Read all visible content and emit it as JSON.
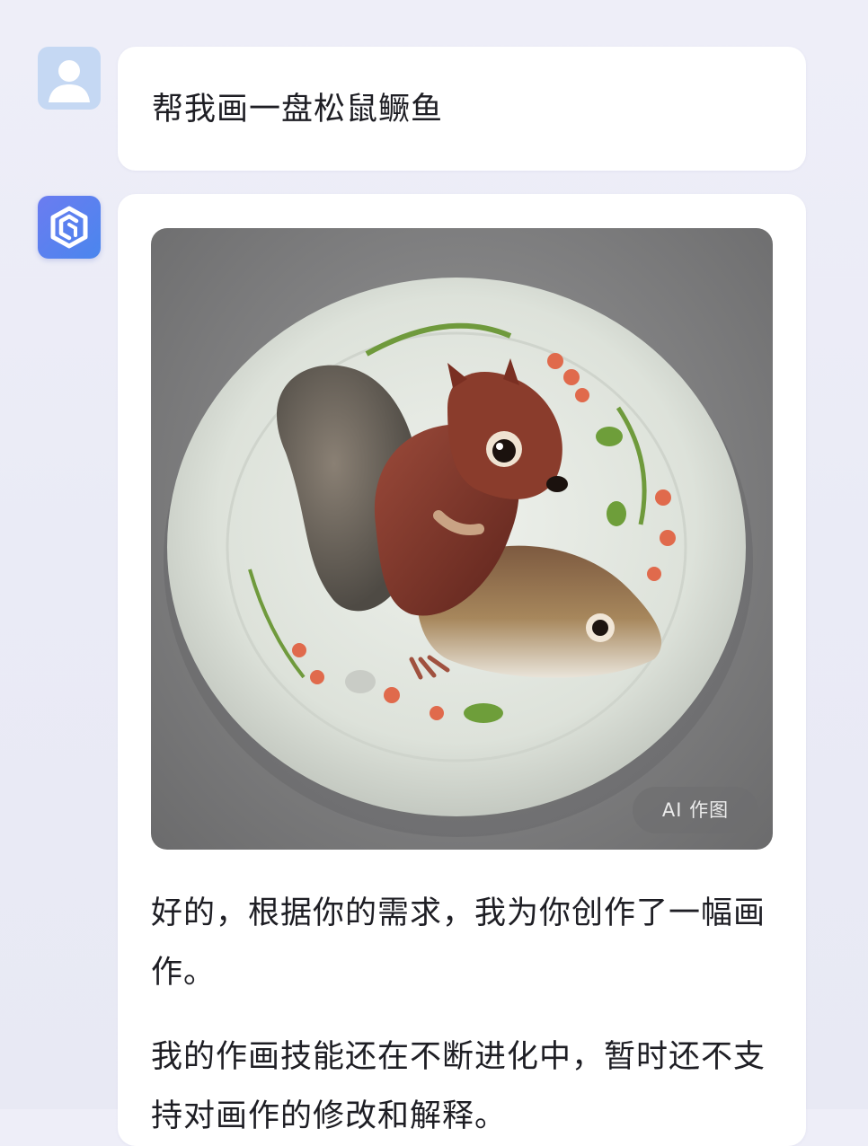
{
  "conversation": {
    "user_message": {
      "text": "帮我画一盘松鼠鳜鱼"
    },
    "bot_message": {
      "image_badge": "AI 作图",
      "paragraph_1": "好的，根据你的需求，我为你创作了一幅画作。",
      "paragraph_2": "我的作画技能还在不断进化中，暂时还不支持对画作的修改和解释。"
    }
  },
  "colors": {
    "background": "#eceef8",
    "bubble": "#ffffff",
    "user_avatar": "#c5d8f3",
    "bot_avatar": "#5b7ff0",
    "text": "#1e1e24"
  },
  "icons": {
    "user_avatar": "person-silhouette-icon",
    "bot_avatar": "bot-logo-icon"
  }
}
